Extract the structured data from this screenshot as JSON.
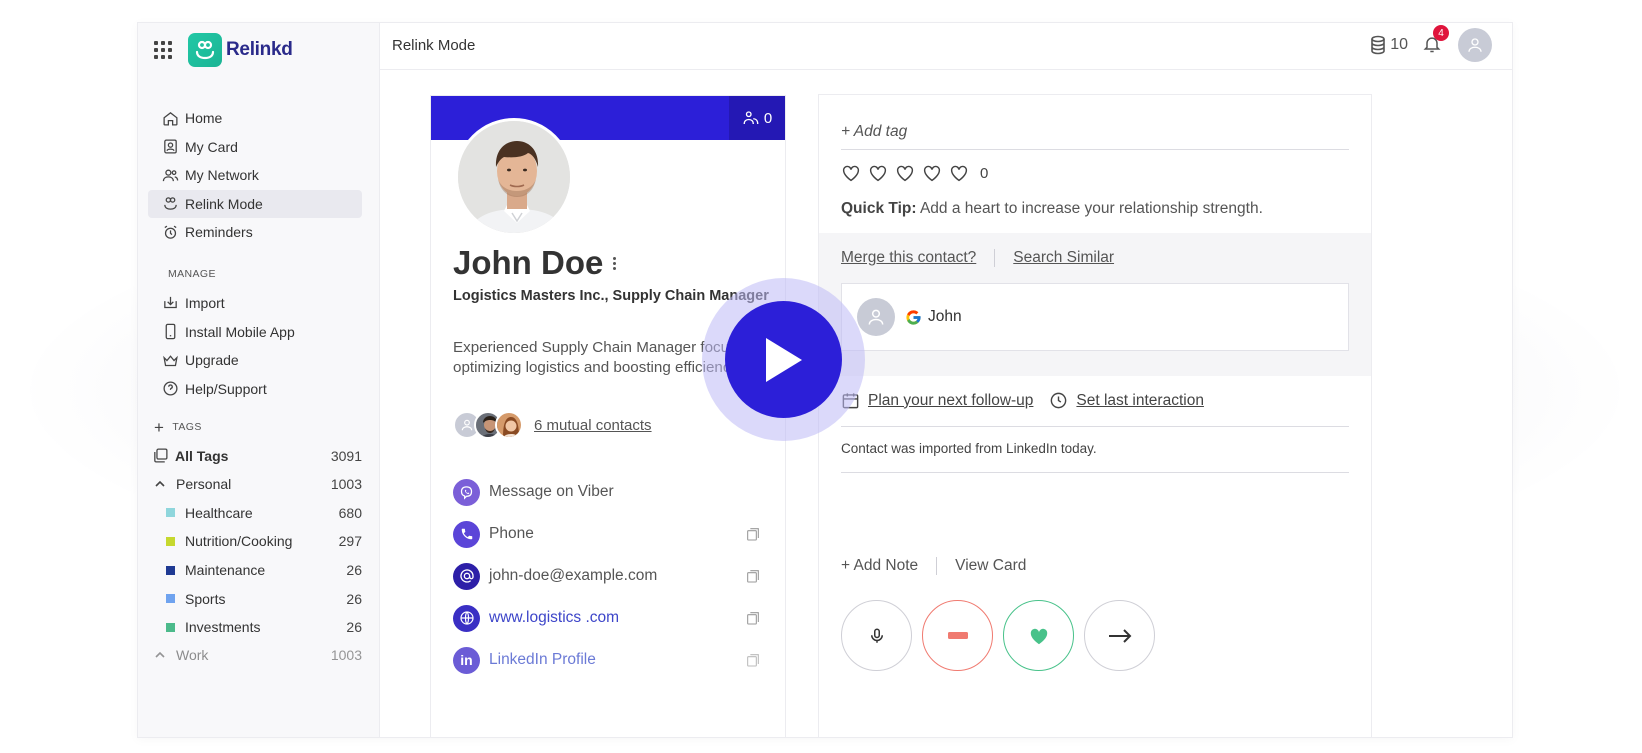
{
  "app": {
    "brand": "Relinkd",
    "page_title": "Relink Mode"
  },
  "header": {
    "coins": "10",
    "notifications": "4"
  },
  "sidebar": {
    "nav": [
      {
        "label": "Home",
        "icon": "home-icon"
      },
      {
        "label": "My Card",
        "icon": "card-icon"
      },
      {
        "label": "My Network",
        "icon": "network-icon"
      },
      {
        "label": "Relink Mode",
        "icon": "relink-icon",
        "active": true
      },
      {
        "label": "Reminders",
        "icon": "alarm-icon"
      }
    ],
    "manage_label": "MANAGE",
    "manage": [
      {
        "label": "Import",
        "icon": "import-icon"
      },
      {
        "label": "Install Mobile App",
        "icon": "mobile-icon"
      },
      {
        "label": "Upgrade",
        "icon": "crown-icon"
      },
      {
        "label": "Help/Support",
        "icon": "help-icon"
      }
    ],
    "tags_label": "TAGS",
    "all_tags": {
      "label": "All Tags",
      "count": "3091"
    },
    "personal": {
      "label": "Personal",
      "count": "1003"
    },
    "personal_tags": [
      {
        "label": "Healthcare",
        "count": "680",
        "color": "#8fd6dc"
      },
      {
        "label": "Nutrition/Cooking",
        "count": "297",
        "color": "#c6d82e"
      },
      {
        "label": "Maintenance",
        "count": "26",
        "color": "#1f3a93"
      },
      {
        "label": "Sports",
        "count": "26",
        "color": "#6fa3ef"
      },
      {
        "label": "Investments",
        "count": "26",
        "color": "#4cba8b"
      }
    ],
    "work": {
      "label": "Work",
      "count": "1003"
    }
  },
  "profile": {
    "network_count": "0",
    "name": "John Doe",
    "company": "Logistics Masters Inc., Supply Chain Manager",
    "bio": "Experienced Supply Chain Manager focused on optimizing logistics and boosting efficiency.",
    "mutual": "6 mutual contacts",
    "contacts": [
      {
        "label": "Message on Viber",
        "icon": "viber-icon",
        "color": "#7b5fd8",
        "style": "plain",
        "copy": false
      },
      {
        "label": "Phone",
        "icon": "phone-icon",
        "color": "#5b45d8",
        "style": "plain",
        "copy": true
      },
      {
        "label": "john-doe@example.com",
        "icon": "at-icon",
        "color": "#2d1fa8",
        "style": "plain",
        "copy": true
      },
      {
        "label": "www.logistics .com",
        "icon": "globe-icon",
        "color": "#3a2fc4",
        "style": "link",
        "copy": true
      },
      {
        "label": "LinkedIn Profile",
        "icon": "linkedin-icon",
        "color": "#6b5cd6",
        "style": "link2",
        "copy": true
      }
    ]
  },
  "panel": {
    "add_tag": "+ Add tag",
    "heart_count": "0",
    "tip_label": "Quick Tip:",
    "tip_text": " Add a heart to increase your relationship strength.",
    "merge": "Merge this contact?",
    "search_similar": "Search Similar",
    "dup_name": "John",
    "follow_up": "Plan your next follow-up",
    "last_interaction": "Set last interaction",
    "log": "Contact was imported from LinkedIn today.",
    "add_note": "+ Add Note",
    "view_card": "View Card"
  }
}
